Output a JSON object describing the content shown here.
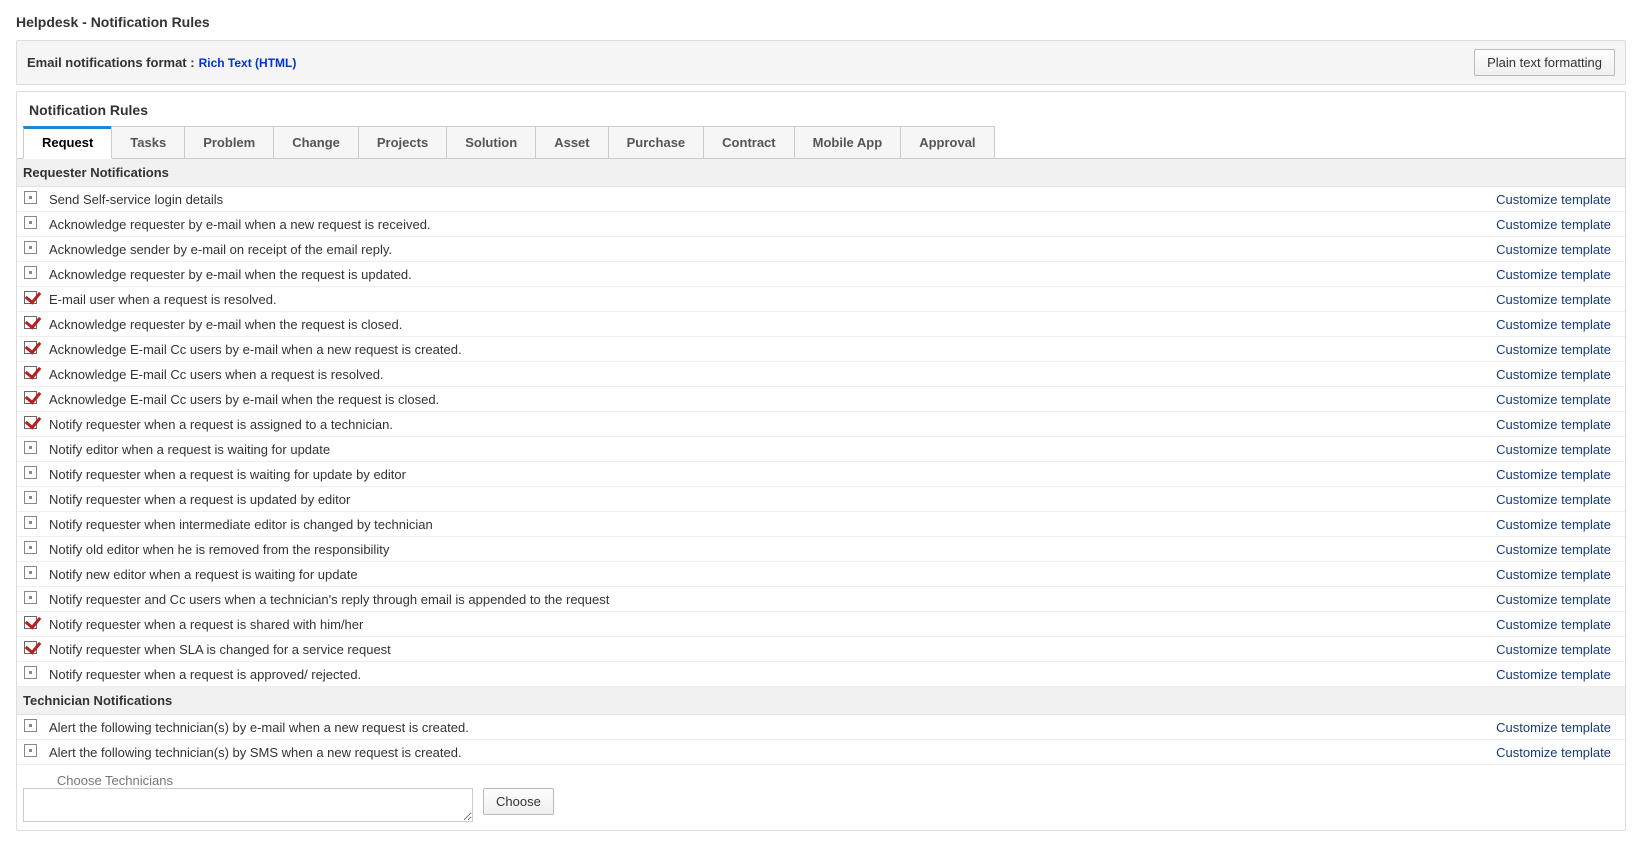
{
  "page_title": "Helpdesk - Notification Rules",
  "format_bar": {
    "label": "Email notifications format :",
    "value": "Rich Text (HTML)",
    "button": "Plain text formatting"
  },
  "panel_title": "Notification Rules",
  "tabs": [
    "Request",
    "Tasks",
    "Problem",
    "Change",
    "Projects",
    "Solution",
    "Asset",
    "Purchase",
    "Contract",
    "Mobile App",
    "Approval"
  ],
  "active_tab": 0,
  "customize_label": "Customize template",
  "sections": [
    {
      "heading": "Requester Notifications",
      "rules": [
        {
          "checked": false,
          "text": "Send Self-service login details"
        },
        {
          "checked": false,
          "text": "Acknowledge requester by e-mail when a new request is received."
        },
        {
          "checked": false,
          "text": "Acknowledge sender by e-mail on receipt of the email reply."
        },
        {
          "checked": false,
          "text": "Acknowledge requester by e-mail when the request is updated."
        },
        {
          "checked": true,
          "text": "E-mail user when a request is resolved."
        },
        {
          "checked": true,
          "text": "Acknowledge requester by e-mail when the request is closed."
        },
        {
          "checked": true,
          "text": "Acknowledge E-mail Cc users by e-mail when a new request is created."
        },
        {
          "checked": true,
          "text": "Acknowledge E-mail Cc users when a request is resolved."
        },
        {
          "checked": true,
          "text": "Acknowledge E-mail Cc users by e-mail when the request is closed."
        },
        {
          "checked": true,
          "text": "Notify requester when a request is assigned to a technician."
        },
        {
          "checked": false,
          "text": "Notify editor when a request is waiting for update"
        },
        {
          "checked": false,
          "text": "Notify requester when a request is waiting for update by editor"
        },
        {
          "checked": false,
          "text": "Notify requester when a request is updated by editor"
        },
        {
          "checked": false,
          "text": "Notify requester when intermediate editor is changed by technician"
        },
        {
          "checked": false,
          "text": "Notify old editor when he is removed from the responsibility"
        },
        {
          "checked": false,
          "text": "Notify new editor when a request is waiting for update"
        },
        {
          "checked": false,
          "text": "Notify requester and Cc users when a technician's reply through email is appended to the request"
        },
        {
          "checked": true,
          "text": "Notify requester when a request is shared with him/her"
        },
        {
          "checked": true,
          "text": "Notify requester when SLA is changed for a service request"
        },
        {
          "checked": false,
          "text": "Notify requester when a request is approved/ rejected."
        }
      ]
    },
    {
      "heading": "Technician Notifications",
      "rules": [
        {
          "checked": false,
          "text": "Alert the following technician(s) by e-mail when a new request is created."
        },
        {
          "checked": false,
          "text": "Alert the following technician(s) by SMS when a new request is created."
        }
      ]
    }
  ],
  "chooser": {
    "label": "Choose Technicians",
    "value": "",
    "button": "Choose"
  }
}
